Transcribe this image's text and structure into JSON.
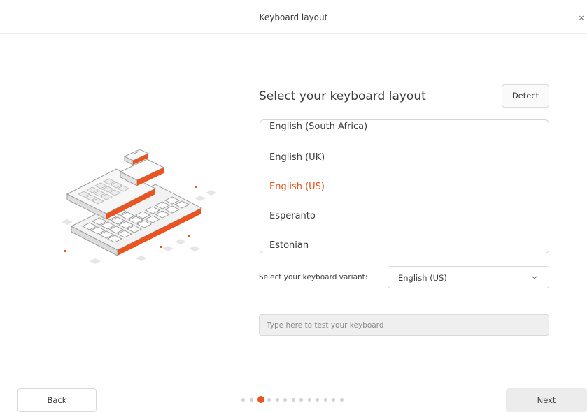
{
  "window": {
    "title": "Keyboard layout",
    "close_label": "×"
  },
  "main": {
    "heading": "Select your keyboard layout",
    "detect_label": "Detect",
    "layouts": [
      {
        "label": "English (South Africa)",
        "selected": false
      },
      {
        "label": "English (UK)",
        "selected": false
      },
      {
        "label": "English (US)",
        "selected": true
      },
      {
        "label": "Esperanto",
        "selected": false
      },
      {
        "label": "Estonian",
        "selected": false
      }
    ],
    "variant_label": "Select your keyboard variant:",
    "variant_value": "English (US)",
    "test_placeholder": "Type here to test your keyboard"
  },
  "footer": {
    "back_label": "Back",
    "next_label": "Next",
    "steps_total": 13,
    "current_step": 3
  },
  "colors": {
    "accent": "#e95420",
    "selected_text": "#e0521f"
  },
  "icons": {
    "illustration": "keyboard-illustration",
    "dropdown": "chevron-down-icon",
    "close": "close-icon"
  }
}
